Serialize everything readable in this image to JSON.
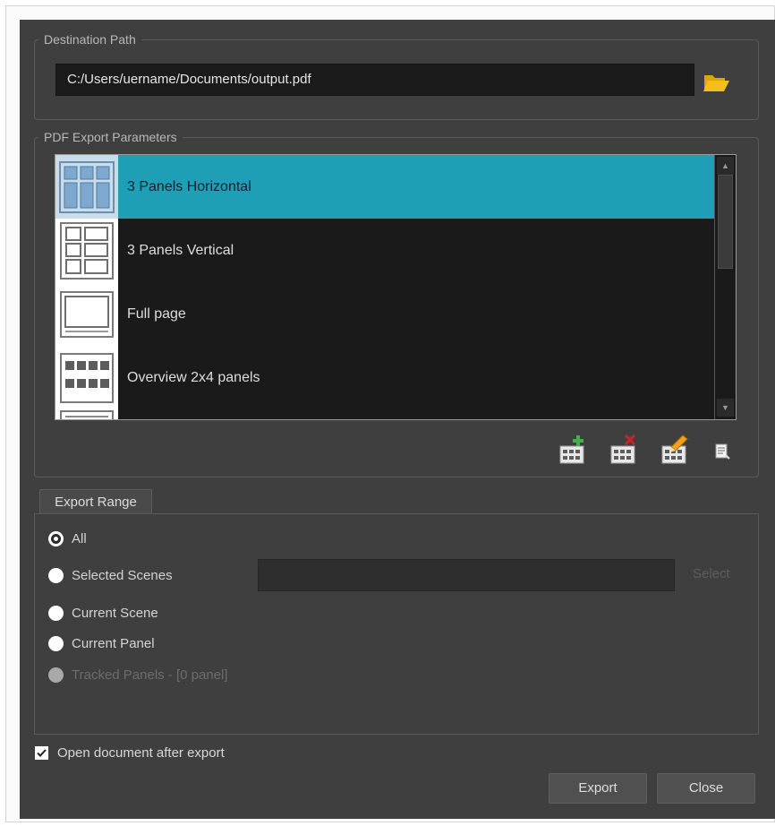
{
  "destination": {
    "group_title": "Destination Path",
    "path_value": "C:/Users/uername/Documents/output.pdf",
    "browse_icon": "folder-open-icon"
  },
  "parameters": {
    "group_title": "PDF Export Parameters",
    "items": [
      {
        "label": "3 Panels Horizontal",
        "icon": "layout-3-panels-horizontal-icon",
        "selected": true
      },
      {
        "label": "3 Panels Vertical",
        "icon": "layout-3-panels-vertical-icon",
        "selected": false
      },
      {
        "label": "Full page",
        "icon": "layout-full-page-icon",
        "selected": false
      },
      {
        "label": "Overview 2x4 panels",
        "icon": "layout-overview-2x4-icon",
        "selected": false
      }
    ],
    "tools": [
      "add-layout-icon",
      "delete-layout-icon",
      "edit-layout-icon",
      "duplicate-layout-icon"
    ]
  },
  "export_range": {
    "tab_label": "Export Range",
    "options": [
      {
        "label": "All",
        "checked": true,
        "enabled": true
      },
      {
        "label": "Selected Scenes",
        "checked": false,
        "enabled": true
      },
      {
        "label": "Current Scene",
        "checked": false,
        "enabled": true
      },
      {
        "label": "Current Panel",
        "checked": false,
        "enabled": true
      },
      {
        "label": "Tracked Panels - [0 panel]",
        "checked": false,
        "enabled": false
      }
    ],
    "scenes_value": "",
    "select_label": "Select"
  },
  "open_after_export": {
    "label": "Open document after export",
    "checked": true
  },
  "buttons": {
    "export_label": "Export",
    "close_label": "Close"
  },
  "colors": {
    "dialog_bg": "#3f3f3f",
    "selection": "#1f9fb6",
    "list_bg": "#1a1a1a"
  }
}
